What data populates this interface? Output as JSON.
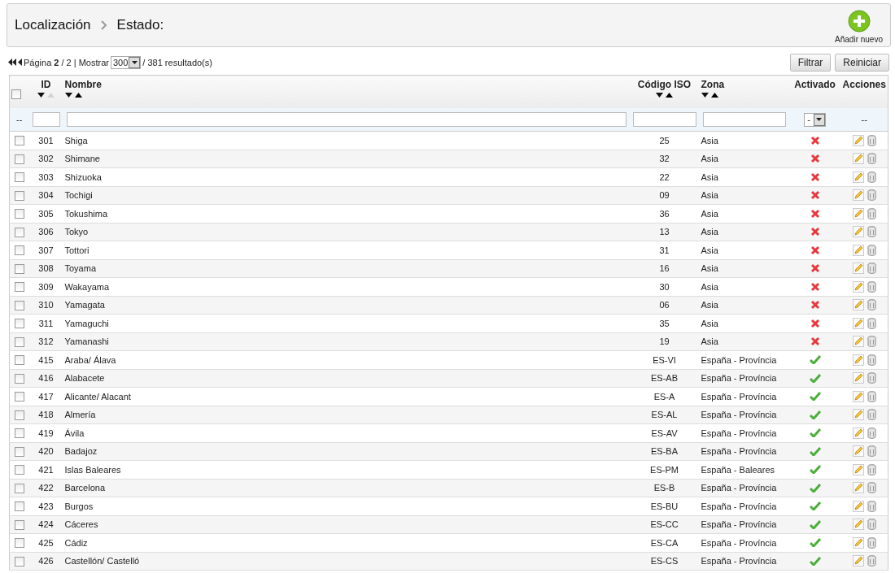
{
  "header": {
    "breadcrumb": [
      "Localización",
      "Estado:"
    ],
    "add_button": "Añadir nuevo"
  },
  "pagination": {
    "page_text": "Página **2** / 2 | Mostrar",
    "per_page": "300",
    "results": "/ 381 resultado(s)"
  },
  "filter_buttons": [
    "Filtrar",
    "Reiniciar"
  ],
  "table": {
    "select_all_checked": false,
    "columns": [
      {
        "label": "ID",
        "sortable": true,
        "sorted_asc": true
      },
      {
        "label": "Nombre",
        "sortable": true,
        "sorted_asc": false
      },
      {
        "label": "Código ISO",
        "sortable": true,
        "sorted_asc": false
      },
      {
        "label": "Zona",
        "sortable": true,
        "sorted_asc": false
      },
      {
        "label": "Activado",
        "sortable": false
      },
      {
        "label": "Acciones",
        "sortable": false
      }
    ],
    "filter_row": {
      "lead": "--",
      "active_select": "-",
      "actions": "--"
    },
    "rows": [
      {
        "id": "301",
        "name": "Shiga",
        "iso": "25",
        "zone": "Asia",
        "active": false,
        "checked": false
      },
      {
        "id": "302",
        "name": "Shimane",
        "iso": "32",
        "zone": "Asia",
        "active": false,
        "checked": false
      },
      {
        "id": "303",
        "name": "Shizuoka",
        "iso": "22",
        "zone": "Asia",
        "active": false,
        "checked": false
      },
      {
        "id": "304",
        "name": "Tochigi",
        "iso": "09",
        "zone": "Asia",
        "active": false,
        "checked": false
      },
      {
        "id": "305",
        "name": "Tokushima",
        "iso": "36",
        "zone": "Asia",
        "active": false,
        "checked": false
      },
      {
        "id": "306",
        "name": "Tokyo",
        "iso": "13",
        "zone": "Asia",
        "active": false,
        "checked": false
      },
      {
        "id": "307",
        "name": "Tottori",
        "iso": "31",
        "zone": "Asia",
        "active": false,
        "checked": false
      },
      {
        "id": "308",
        "name": "Toyama",
        "iso": "16",
        "zone": "Asia",
        "active": false,
        "checked": false
      },
      {
        "id": "309",
        "name": "Wakayama",
        "iso": "30",
        "zone": "Asia",
        "active": false,
        "checked": false
      },
      {
        "id": "310",
        "name": "Yamagata",
        "iso": "06",
        "zone": "Asia",
        "active": false,
        "checked": false
      },
      {
        "id": "311",
        "name": "Yamaguchi",
        "iso": "35",
        "zone": "Asia",
        "active": false,
        "checked": false
      },
      {
        "id": "312",
        "name": "Yamanashi",
        "iso": "19",
        "zone": "Asia",
        "active": false,
        "checked": false
      },
      {
        "id": "415",
        "name": "Araba/ Álava",
        "iso": "ES-VI",
        "zone": "España - Província",
        "active": true,
        "checked": false
      },
      {
        "id": "416",
        "name": "Alabacete",
        "iso": "ES-AB",
        "zone": "España - Província",
        "active": true,
        "checked": false
      },
      {
        "id": "417",
        "name": "Alicante/ Alacant",
        "iso": "ES-A",
        "zone": "España - Província",
        "active": true,
        "checked": false
      },
      {
        "id": "418",
        "name": "Almería",
        "iso": "ES-AL",
        "zone": "España - Província",
        "active": true,
        "checked": false
      },
      {
        "id": "419",
        "name": "Ávila",
        "iso": "ES-AV",
        "zone": "España - Província",
        "active": true,
        "checked": false
      },
      {
        "id": "420",
        "name": "Badajoz",
        "iso": "ES-BA",
        "zone": "España - Província",
        "active": true,
        "checked": false
      },
      {
        "id": "421",
        "name": "Islas Baleares",
        "iso": "ES-PM",
        "zone": "España - Baleares",
        "active": true,
        "checked": false
      },
      {
        "id": "422",
        "name": "Barcelona",
        "iso": "ES-B",
        "zone": "España - Província",
        "active": true,
        "checked": false
      },
      {
        "id": "423",
        "name": "Burgos",
        "iso": "ES-BU",
        "zone": "España - Província",
        "active": true,
        "checked": false
      },
      {
        "id": "424",
        "name": "Cáceres",
        "iso": "ES-CC",
        "zone": "España - Província",
        "active": true,
        "checked": false
      },
      {
        "id": "425",
        "name": "Cádiz",
        "iso": "ES-CA",
        "zone": "España - Província",
        "active": true,
        "checked": false
      },
      {
        "id": "426",
        "name": "Castellón/ Castelló",
        "iso": "ES-CS",
        "zone": "España - Província",
        "active": true,
        "checked": false
      }
    ]
  }
}
